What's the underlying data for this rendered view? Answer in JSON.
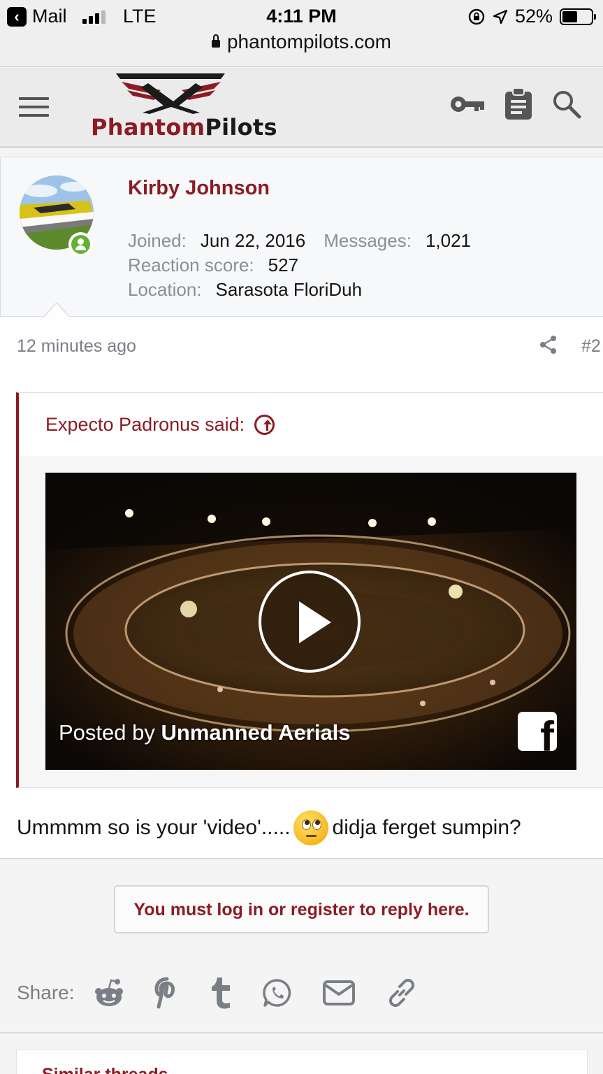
{
  "status_bar": {
    "back_app": "Mail",
    "network": "LTE",
    "time": "4:11 PM",
    "battery": "52%",
    "battery_level": 0.52
  },
  "browser": {
    "url": "phantompilots.com"
  },
  "header": {
    "logo_part1": "Phantom",
    "logo_part2": "Pilots",
    "icons": [
      "menu-icon",
      "key-icon",
      "clipboard-icon",
      "search-icon"
    ]
  },
  "author": {
    "name": "Kirby Johnson",
    "joined_label": "Joined:",
    "joined": "Jun 22, 2016",
    "messages_label": "Messages:",
    "messages": "1,021",
    "reaction_label": "Reaction score:",
    "reaction": "527",
    "location_label": "Location:",
    "location": "Sarasota FloriDuh",
    "online": true
  },
  "post": {
    "time": "12 minutes ago",
    "number": "#2",
    "quote": {
      "author_said": "Expecto Padronus said:",
      "video_posted_by": "Posted by",
      "video_author": "Unmanned Aerials"
    },
    "text_before": "Ummmm so is your 'video'.....",
    "text_after": "didja ferget sumpin?"
  },
  "login_prompt": "You must log in or register to reply here.",
  "share": {
    "label": "Share:",
    "icons": [
      "reddit-icon",
      "pinterest-icon",
      "tumblr-icon",
      "whatsapp-icon",
      "email-icon",
      "link-icon"
    ]
  },
  "similar_threads": "Similar threads",
  "colors": {
    "brand": "#8b1c24",
    "online": "#63b132"
  }
}
